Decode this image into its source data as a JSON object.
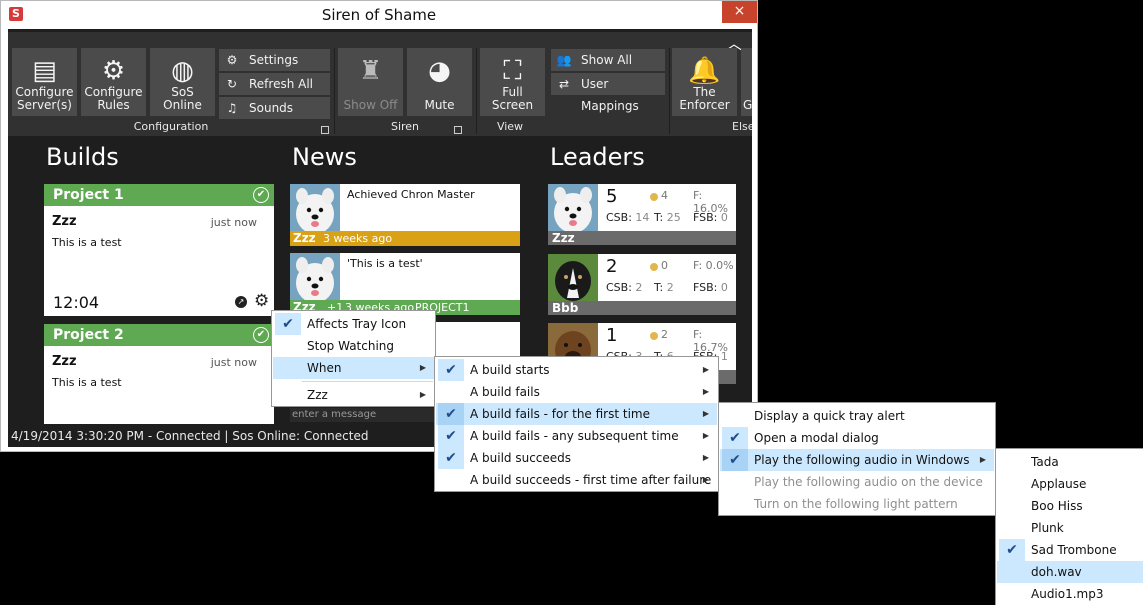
{
  "window": {
    "title": "Siren of Shame",
    "close": "×",
    "app_icon": "S"
  },
  "ribbon": {
    "configure_servers": "Configure Server(s)",
    "configure_rules": "Configure Rules",
    "sos_online": "SoS Online",
    "settings": "Settings",
    "refresh_all": "Refresh All",
    "sounds": "Sounds",
    "group_configuration": "Configuration",
    "show_off": "Show Off",
    "mute": "Mute",
    "group_siren": "Siren",
    "full_screen": "Full Screen",
    "show_all_users": "Show All Users",
    "user_mappings": "User Mappings",
    "group_view": "View",
    "the_enforcer": "The Enforcer",
    "partial_button": "G",
    "group_else": "Else"
  },
  "headings": {
    "builds": "Builds",
    "news": "News",
    "leaders": "Leaders"
  },
  "builds": [
    {
      "project": "Project 1",
      "user": "Zzz",
      "time": "just now",
      "message": "This is a test",
      "duration": "12:04"
    },
    {
      "project": "Project 2",
      "user": "Zzz",
      "time": "just now",
      "message": "This is a test"
    }
  ],
  "news": [
    {
      "text": "Achieved Chron Master",
      "user": "Zzz",
      "ago": "3 weeks ago",
      "bar_color": "#d9a116"
    },
    {
      "text": "'This is a test'",
      "user": "Zzz",
      "extra": "+1",
      "ago": "3 weeks ago",
      "project": "PROJECT1",
      "bar_color": "#5fa952"
    }
  ],
  "message_placeholder": "enter a message",
  "leaders": [
    {
      "rank": "5",
      "points": "4",
      "f": "F: 16.0%",
      "csb_label": "CSB:",
      "csb": "14",
      "t_label": "T:",
      "t": "25",
      "fsb_label": "FSB:",
      "fsb": "0",
      "name": "Zzz"
    },
    {
      "rank": "2",
      "points": "0",
      "f": "F: 0.0%",
      "csb_label": "CSB:",
      "csb": "2",
      "t_label": "T:",
      "t": "2",
      "fsb_label": "FSB:",
      "fsb": "0",
      "name": "Bbb"
    },
    {
      "rank": "1",
      "points": "2",
      "f": "F: 16.7%",
      "csb_label": "CSB:",
      "csb": "3",
      "t_label": "T:",
      "t": "6",
      "fsb_label": "FSB:",
      "fsb": "1",
      "name": ""
    }
  ],
  "status": {
    "text": "4/19/2014 3:30:20 PM - Connected  |  Sos Online: Connected"
  },
  "menu1": {
    "items": [
      {
        "label": "Affects Tray Icon",
        "checked": true
      },
      {
        "label": "Stop Watching",
        "checked": false
      },
      {
        "label": "When",
        "checked": false,
        "submenu": true,
        "selected": true
      },
      {
        "label": "Zzz",
        "checked": false,
        "submenu": true
      }
    ]
  },
  "menu2": {
    "items": [
      {
        "label": "A build starts",
        "checked": true
      },
      {
        "label": "A build fails",
        "checked": false
      },
      {
        "label": "A build fails - for the first time",
        "checked": true,
        "selected": true
      },
      {
        "label": "A build fails - any subsequent time",
        "checked": true
      },
      {
        "label": "A build succeeds",
        "checked": true
      },
      {
        "label": "A build succeeds - first time after failure",
        "checked": false
      }
    ]
  },
  "menu3": {
    "items": [
      {
        "label": "Display a quick tray alert",
        "checked": false
      },
      {
        "label": "Open a modal dialog",
        "checked": true
      },
      {
        "label": "Play the following audio in Windows",
        "checked": true,
        "submenu": true,
        "selected": true
      },
      {
        "label": "Play the following audio on the device",
        "disabled": true
      },
      {
        "label": "Turn on the following light pattern",
        "disabled": true
      }
    ]
  },
  "menu4": {
    "items": [
      {
        "label": "Tada"
      },
      {
        "label": "Applause"
      },
      {
        "label": "Boo Hiss"
      },
      {
        "label": "Plunk"
      },
      {
        "label": "Sad Trombone",
        "checked": true
      },
      {
        "label": "doh.wav",
        "selected": true
      },
      {
        "label": "Audio1.mp3"
      }
    ]
  },
  "icons": {
    "check": "✔",
    "arrow": "▶"
  },
  "colors": {
    "build_green": "#5fa952",
    "news_gold": "#d9a116",
    "menu_highlight": "#cce8ff",
    "close_red": "#c7432c"
  }
}
